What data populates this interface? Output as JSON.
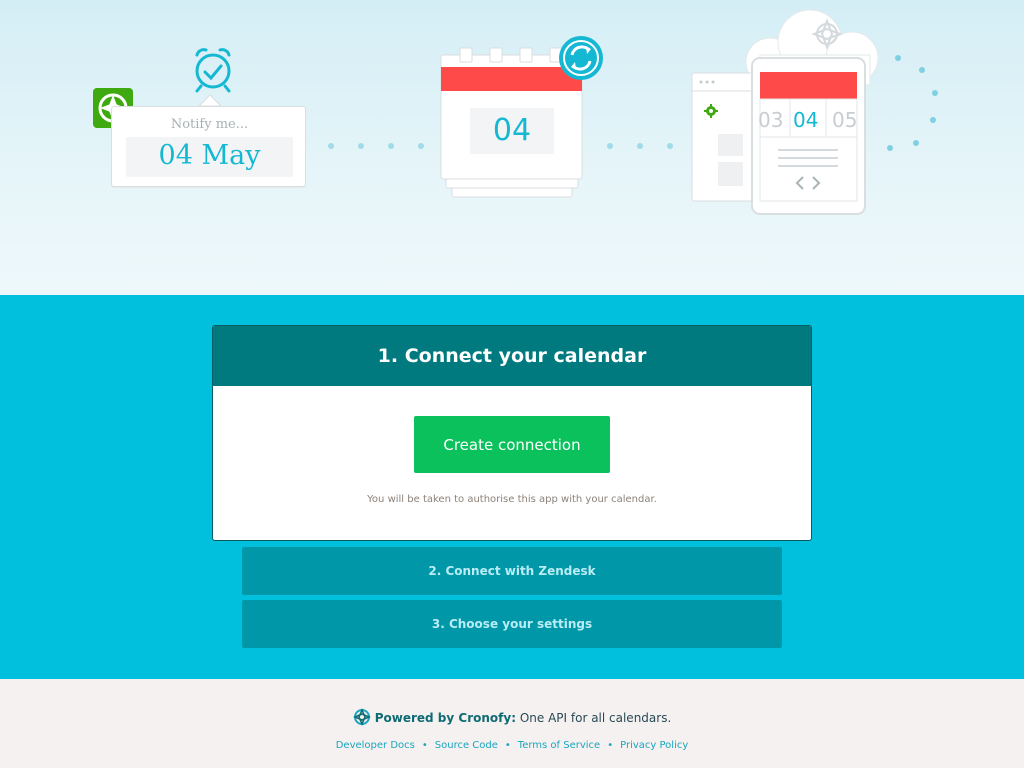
{
  "hero": {
    "notify_label": "Notify me...",
    "notify_date": "04 May",
    "calendar_day": "04",
    "phone_days": [
      "03",
      "04",
      "05"
    ]
  },
  "step1": {
    "title": "1. Connect your calendar",
    "button_label": "Create connection",
    "note": "You will be taken to authorise this app with your calendar."
  },
  "step2": {
    "title": "2. Connect with Zendesk"
  },
  "step3": {
    "title": "3. Choose your settings"
  },
  "footer": {
    "powered_by": "Powered by Cronofy:",
    "tagline": "One API for all calendars.",
    "links": [
      "Developer Docs",
      "Source Code",
      "Terms of Service",
      "Privacy Policy"
    ]
  },
  "colors": {
    "hero_bg": "#dff2f7",
    "band_bg": "#00c0dd",
    "step_header": "#00797f",
    "button_green": "#0ac15c",
    "collapsed_step": "#0098a8",
    "accent_cyan": "#14b8d3",
    "calendar_red": "#ff4a4a",
    "zendesk_green": "#3eaa0f"
  },
  "icons": [
    "zendesk-logo-icon",
    "alarm-clock-icon",
    "sync-icon",
    "cloud-icon",
    "gear-icon",
    "code-icon",
    "cronofy-logo-icon"
  ]
}
